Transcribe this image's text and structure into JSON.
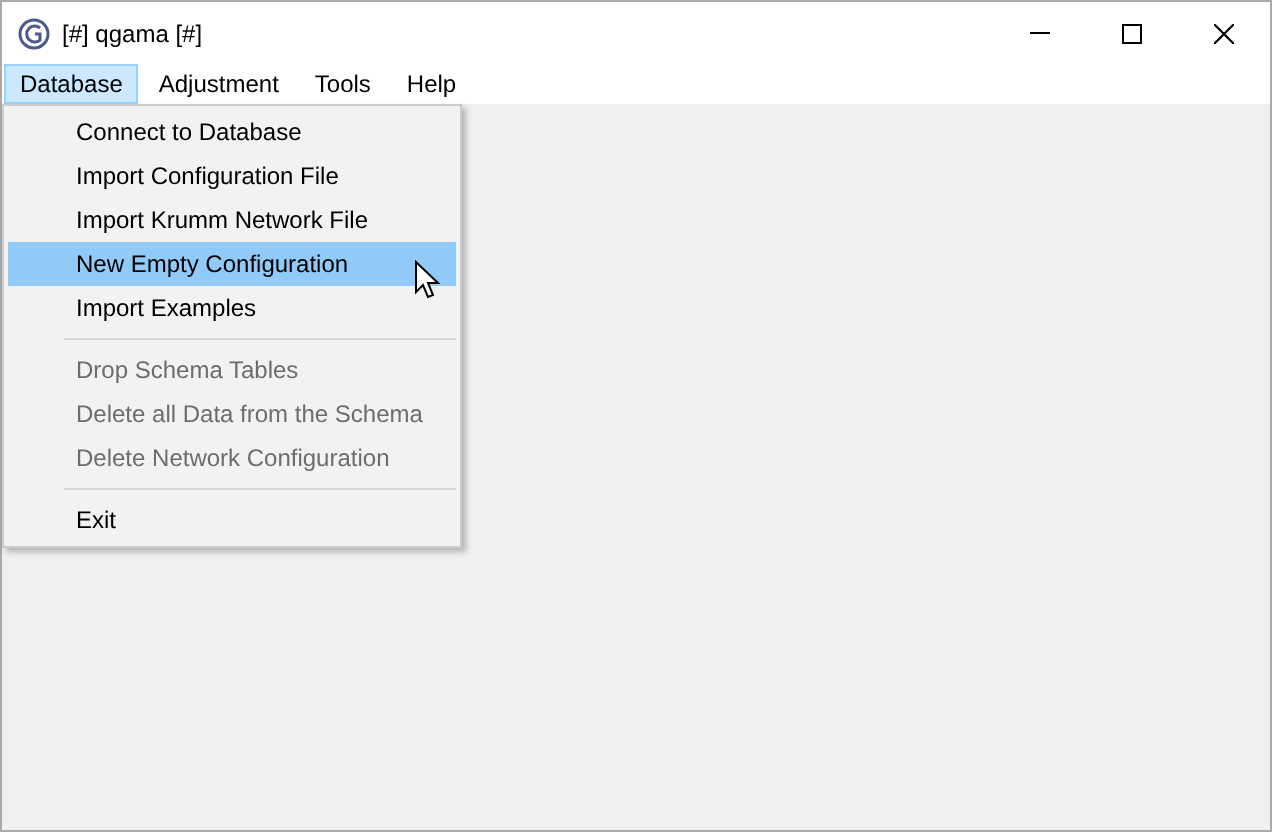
{
  "window": {
    "title": "[#] qgama [#]"
  },
  "menu_bar": [
    {
      "label": "Database",
      "selected": true
    },
    {
      "label": "Adjustment",
      "selected": false
    },
    {
      "label": "Tools",
      "selected": false
    },
    {
      "label": "Help",
      "selected": false
    }
  ],
  "dropdown": [
    {
      "kind": "item",
      "label": "Connect to Database",
      "disabled": false,
      "selected": false
    },
    {
      "kind": "item",
      "label": "Import Configuration File",
      "disabled": false,
      "selected": false
    },
    {
      "kind": "item",
      "label": "Import Krumm Network File",
      "disabled": false,
      "selected": false
    },
    {
      "kind": "item",
      "label": "New Empty Configuration",
      "disabled": false,
      "selected": true
    },
    {
      "kind": "item",
      "label": "Import Examples",
      "disabled": false,
      "selected": false
    },
    {
      "kind": "separator"
    },
    {
      "kind": "item",
      "label": "Drop Schema Tables",
      "disabled": true,
      "selected": false
    },
    {
      "kind": "item",
      "label": "Delete all Data from the Schema",
      "disabled": true,
      "selected": false
    },
    {
      "kind": "item",
      "label": "Delete Network Configuration",
      "disabled": true,
      "selected": false
    },
    {
      "kind": "separator"
    },
    {
      "kind": "item",
      "label": "Exit",
      "disabled": false,
      "selected": false
    }
  ]
}
